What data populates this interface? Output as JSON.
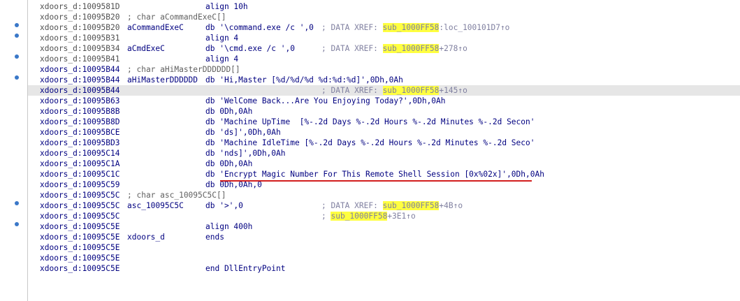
{
  "lines": [
    {
      "addr": "xdoors_d:1009581D",
      "label": "",
      "op": "align 10h",
      "xref": null
    },
    {
      "addr": "xdoors_d:10095B20",
      "comment": "; char aCommandExeC[]"
    },
    {
      "addr": "xdoors_d:10095B20",
      "label": "aCommandExeC",
      "op": "db '\\command.exe /c ',0",
      "xref": {
        "prefix": "; DATA XREF: ",
        "sub": "sub_1000FF58",
        "suffix": ":loc_100101D7↑o"
      }
    },
    {
      "addr": "xdoors_d:10095B31",
      "label": "",
      "op": "align 4",
      "xref": null
    },
    {
      "addr": "xdoors_d:10095B34",
      "label": "aCmdExeC",
      "op": "db '\\cmd.exe /c ',0",
      "xref": {
        "prefix": "; DATA XREF: ",
        "sub": "sub_1000FF58",
        "suffix": "+278↑o"
      }
    },
    {
      "addr": "xdoors_d:10095B41",
      "label": "",
      "op": "align 4",
      "xref": null
    },
    {
      "addr": "xdoors_d:10095B44",
      "comment": "; char aHiMasterDDDDDD[]"
    },
    {
      "addr": "xdoors_d:10095B44",
      "label": "aHiMasterDDDDDD",
      "op": "db 'Hi,Master [%d/%d/%d %d:%d:%d]',0Dh,0Ah",
      "xref": null
    },
    {
      "addr": "xdoors_d:10095B44",
      "label": "",
      "op": "",
      "xref": {
        "prefix": "; DATA XREF: ",
        "sub": "sub_1000FF58",
        "suffix": "+145↑o"
      }
    },
    {
      "addr": "xdoors_d:10095B63",
      "label": "",
      "op": "db 'WelCome Back...Are You Enjoying Today?',0Dh,0Ah",
      "xref": null
    },
    {
      "addr": "xdoors_d:10095B8B",
      "label": "",
      "op": "db 0Dh,0Ah",
      "xref": null
    },
    {
      "addr": "xdoors_d:10095B8D",
      "label": "",
      "op": "db 'Machine UpTime  [%-.2d Days %-.2d Hours %-.2d Minutes %-.2d Secon'",
      "xref": null
    },
    {
      "addr": "xdoors_d:10095BCE",
      "label": "",
      "op": "db 'ds]',0Dh,0Ah",
      "xref": null
    },
    {
      "addr": "xdoors_d:10095BD3",
      "label": "",
      "op": "db 'Machine IdleTime [%-.2d Days %-.2d Hours %-.2d Minutes %-.2d Seco'",
      "xref": null
    },
    {
      "addr": "xdoors_d:10095C14",
      "label": "",
      "op": "db 'nds]',0Dh,0Ah",
      "xref": null
    },
    {
      "addr": "xdoors_d:10095C1A",
      "label": "",
      "op": "db 0Dh,0Ah",
      "xref": null
    },
    {
      "addr": "xdoors_d:10095C1C",
      "label": "",
      "op": "db 'Encrypt Magic Number For This Remote Shell Session [0x%02x]',0Dh,0Ah",
      "xref": null
    },
    {
      "addr": "xdoors_d:10095C59",
      "label": "",
      "op": "db 0Dh,0Ah,0",
      "xref": null
    },
    {
      "addr": "xdoors_d:10095C5C",
      "comment": "; char asc_10095C5C[]"
    },
    {
      "addr": "xdoors_d:10095C5C",
      "label": "asc_10095C5C",
      "op": "db '>',0",
      "xref": {
        "prefix": "; DATA XREF: ",
        "sub": "sub_1000FF58",
        "suffix": "+4B↑o"
      }
    },
    {
      "addr": "xdoors_d:10095C5C",
      "label": "",
      "op": "",
      "xref": {
        "prefix": "; ",
        "sub": "sub_1000FF58",
        "suffix": "+3E1↑o"
      }
    },
    {
      "addr": "xdoors_d:10095C5E",
      "label": "",
      "op": "align 400h",
      "xref": null
    },
    {
      "addr": "xdoors_d:10095C5E",
      "label": "xdoors_d",
      "op": "ends",
      "xref": null
    },
    {
      "addr": "xdoors_d:10095C5E",
      "label": "",
      "op": "",
      "xref": null
    },
    {
      "addr": "xdoors_d:10095C5E",
      "label": "",
      "op": "",
      "xref": null
    },
    {
      "addr": "xdoors_d:10095C5E",
      "label": "",
      "op": "end DllEntryPoint",
      "xref": null
    }
  ],
  "colors": {
    "address": "#505050",
    "code": "#000080",
    "xref": "#8080a0",
    "highlight": "#ffff40",
    "selected_line": "#e6e6e6",
    "underline": "#d21e1e",
    "breakpoint_dot": "#3a78c8"
  }
}
